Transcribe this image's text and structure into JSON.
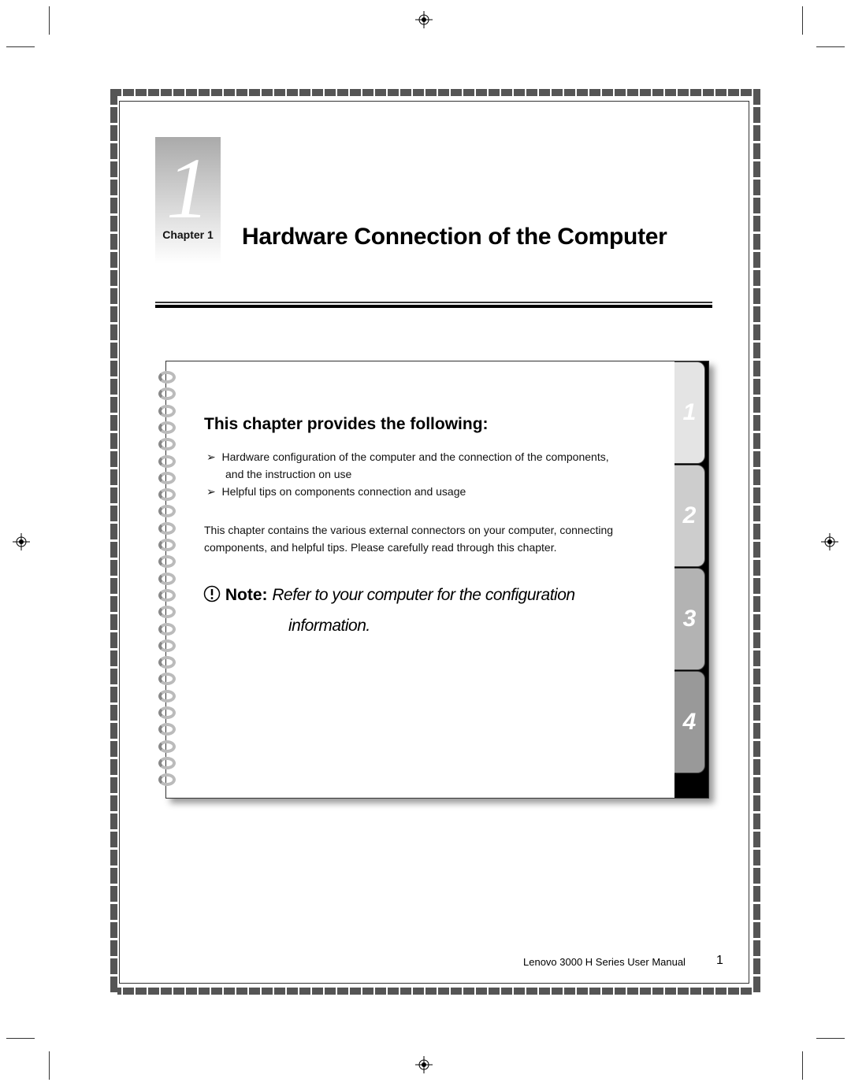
{
  "chapter": {
    "number": "1",
    "label": "Chapter 1",
    "title": "Hardware Connection of the Computer"
  },
  "box": {
    "heading": "This chapter provides the following:",
    "bullets": [
      "Hardware configuration of the computer and the connection of the  components,",
      "and the instruction on use",
      "Helpful tips on components connection and usage"
    ],
    "paragraph": [
      "This chapter contains the various external connectors on your computer, connecting",
      "components, and helpful tips. Please carefully read through this chapter."
    ],
    "note_label": "Note:",
    "note_text": [
      "Refer to your computer for the configuration",
      "information."
    ],
    "tabs": [
      {
        "label": "1",
        "color": "#e4e4e4"
      },
      {
        "label": "2",
        "color": "#cdcdcd"
      },
      {
        "label": "3",
        "color": "#b3b3b3"
      },
      {
        "label": "4",
        "color": "#999999"
      }
    ]
  },
  "footer": {
    "manual": "Lenovo 3000 H Series User Manual",
    "page": "1"
  }
}
